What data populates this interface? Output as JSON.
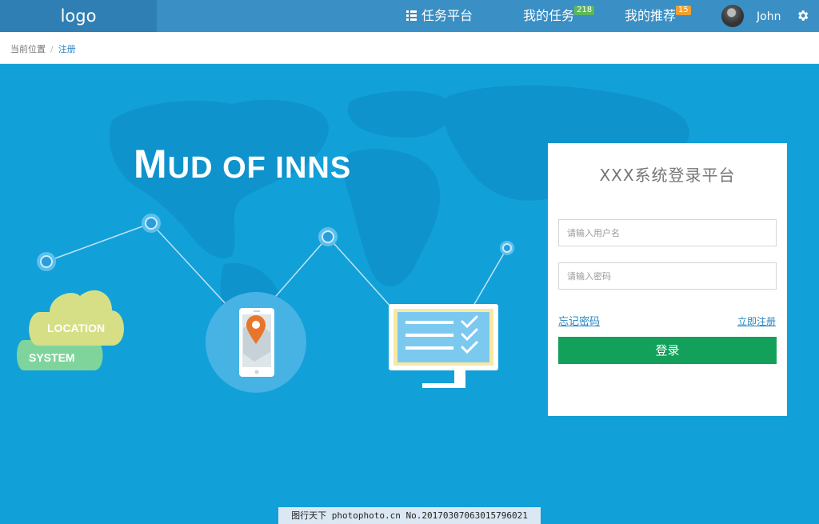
{
  "header": {
    "logo": "logo",
    "nav": [
      {
        "label": "任务平台",
        "icon": "list-icon"
      },
      {
        "label": "我的任务",
        "badge": "218",
        "badge_color": "#5cb85c"
      },
      {
        "label": "我的推荐",
        "badge": "15",
        "badge_color": "#f0a030"
      }
    ],
    "user": "John"
  },
  "breadcrumb": {
    "label": "当前位置",
    "separator": "/",
    "current": "注册"
  },
  "hero": {
    "headline_first": "M",
    "headline_rest": "UD OF INNS",
    "cloud_top": "LOCATION",
    "cloud_bottom": "SYSTEM"
  },
  "login": {
    "title": "XXX系统登录平台",
    "username_placeholder": "请输入用户名",
    "password_placeholder": "请输入密码",
    "forgot": "忘记密码",
    "register": "立即注册",
    "submit": "登录"
  },
  "watermark": "图行天下 photophoto.cn No.20170307063015796021",
  "colors": {
    "nav_bg": "#3a8fc4",
    "hero_bg": "#12a0d8",
    "accent": "#2a85c0",
    "button": "#13a05a"
  }
}
